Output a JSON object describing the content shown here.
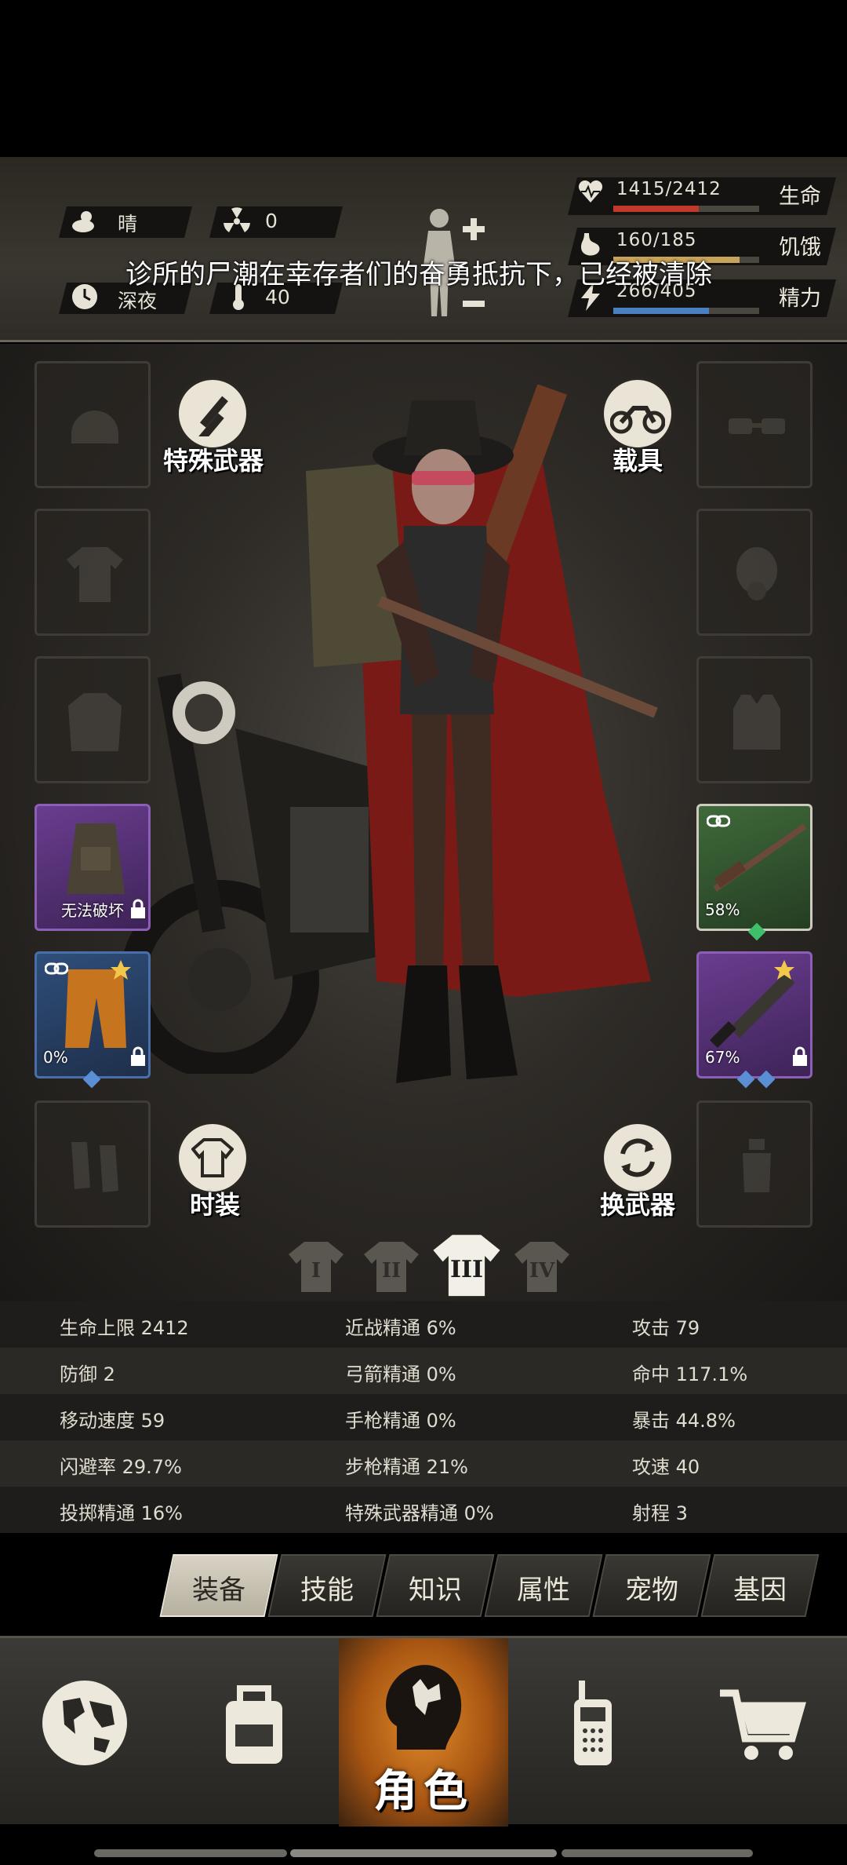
{
  "environment": {
    "weather": "晴",
    "radiation": "0",
    "time_of_day": "深夜",
    "temperature": "40"
  },
  "vitals": [
    {
      "label": "生命",
      "value": "1415/2412",
      "fraction": 0.587,
      "color": "#c0392b",
      "icon": "heart-icon"
    },
    {
      "label": "饥饿",
      "value": "160/185",
      "fraction": 0.865,
      "color": "#c8a35a",
      "icon": "stomach-icon"
    },
    {
      "label": "精力",
      "value": "266/405",
      "fraction": 0.657,
      "color": "#4a7fc1",
      "icon": "lightning-icon"
    }
  ],
  "news": "诊所的尸潮在幸存者们的奋勇抵抗下，已经被清除",
  "character": {
    "special_weapon_label": "特殊武器",
    "vehicle_label": "载具",
    "fashion_label": "时装",
    "swap_weapon_label": "换武器",
    "left_slots": [
      {
        "name": "helmet",
        "state": "empty"
      },
      {
        "name": "shirt",
        "state": "empty"
      },
      {
        "name": "coat",
        "state": "empty"
      },
      {
        "name": "backpack",
        "state": "filled",
        "label": "无法破坏"
      },
      {
        "name": "pants",
        "state": "filled",
        "percent": "0%"
      },
      {
        "name": "shoes",
        "state": "empty"
      }
    ],
    "right_slots": [
      {
        "name": "glasses",
        "state": "empty"
      },
      {
        "name": "gas-mask",
        "state": "empty"
      },
      {
        "name": "vest",
        "state": "empty"
      },
      {
        "name": "rifle",
        "state": "filled",
        "percent": "58%"
      },
      {
        "name": "machete",
        "state": "filled",
        "percent": "67%"
      },
      {
        "name": "grenade",
        "state": "empty"
      }
    ],
    "outfit_tabs": [
      "I",
      "II",
      "III",
      "IV"
    ],
    "active_outfit": 2
  },
  "attributes": [
    [
      "生命上限 2412",
      "近战精通 6%",
      "攻击 79"
    ],
    [
      "防御 2",
      "弓箭精通 0%",
      "命中 117.1%"
    ],
    [
      "移动速度 59",
      "手枪精通 0%",
      "暴击 44.8%"
    ],
    [
      "闪避率 29.7%",
      "步枪精通 21%",
      "攻速 40"
    ],
    [
      "投掷精通 16%",
      "特殊武器精通 0%",
      "射程 3"
    ]
  ],
  "subtabs": [
    "装备",
    "技能",
    "知识",
    "属性",
    "宠物",
    "基因"
  ],
  "active_subtab": 0,
  "nav": [
    {
      "name": "world",
      "icon": "globe-icon"
    },
    {
      "name": "inventory",
      "icon": "backpack-icon"
    },
    {
      "name": "character",
      "icon": "head-icon",
      "label": "角色"
    },
    {
      "name": "radio",
      "icon": "walkie-talkie-icon"
    },
    {
      "name": "shop",
      "icon": "cart-icon"
    }
  ],
  "colors": {
    "accent_orange": "#e08a2a",
    "purple_rarity": "#6a3d8f",
    "green_rarity": "#3f6a3a"
  }
}
